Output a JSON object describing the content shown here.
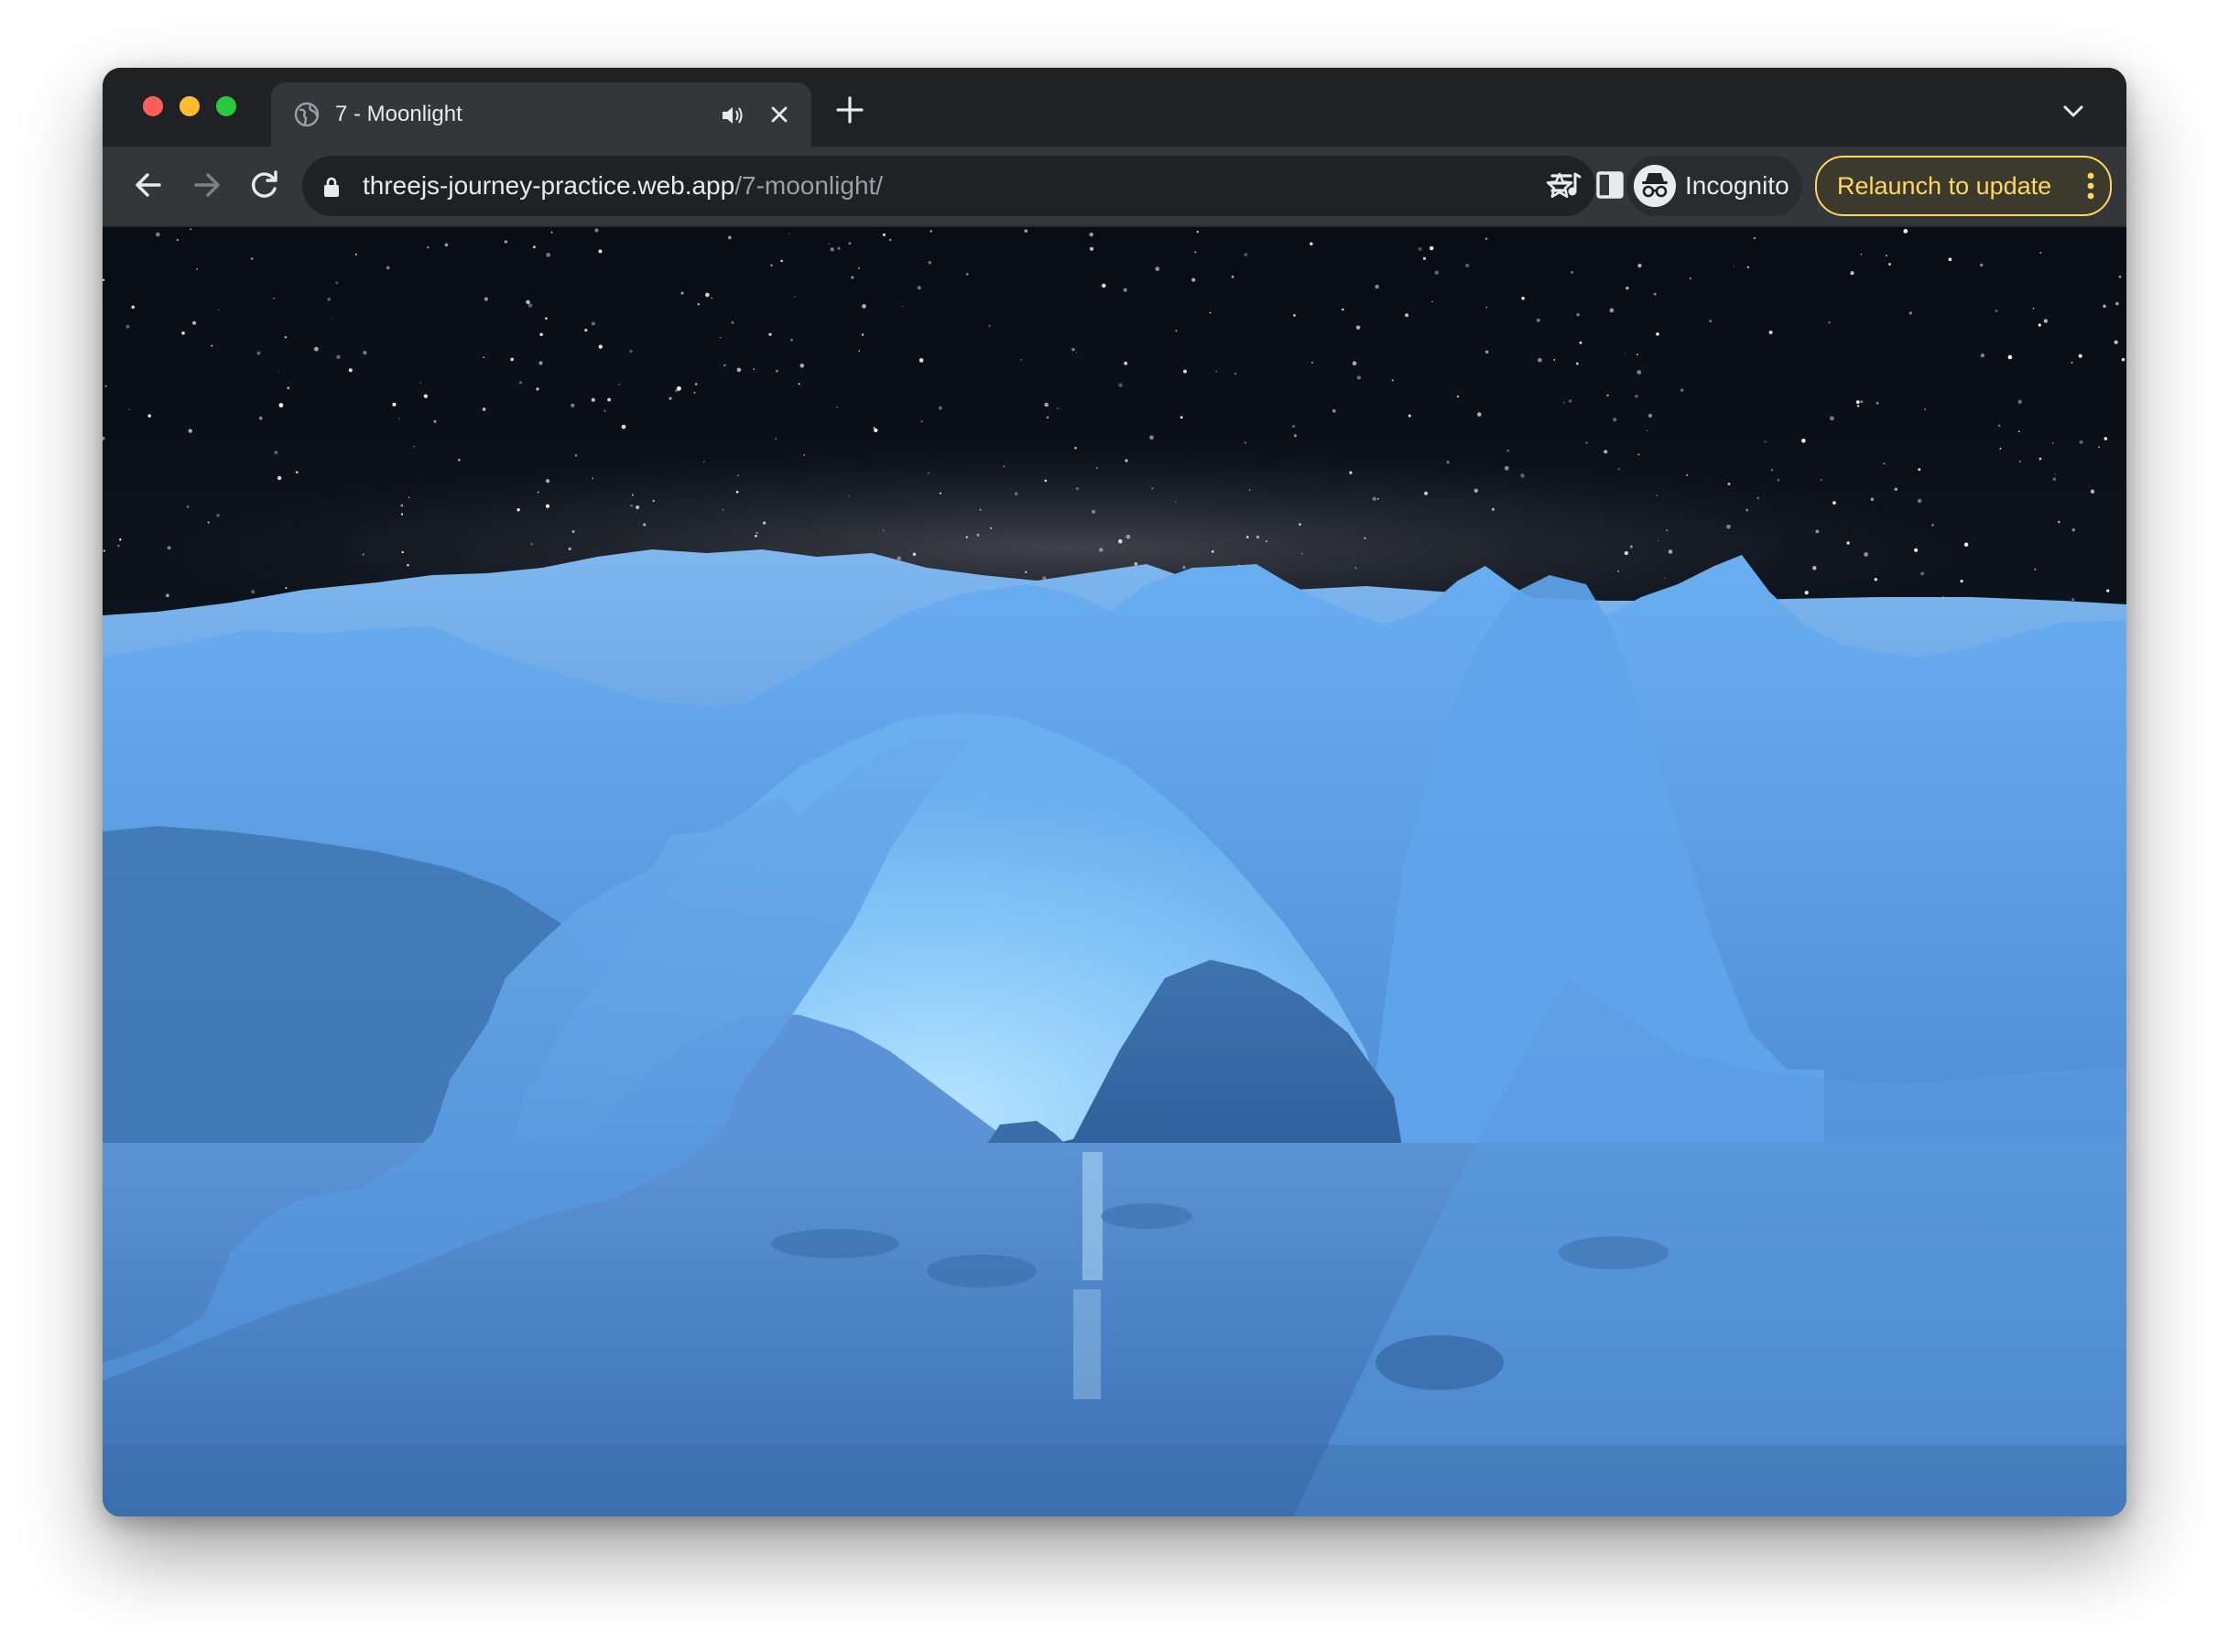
{
  "window": {
    "controls": {
      "close": "close-window",
      "minimize": "minimize-window",
      "zoom": "zoom-window"
    }
  },
  "tab": {
    "title": "7 - Moonlight",
    "favicon": "globe-icon",
    "audio_icon": "speaker-icon",
    "close_icon": "close-icon"
  },
  "tabstrip": {
    "new_tab_icon": "plus-icon",
    "tab_search_icon": "chevron-down-icon"
  },
  "toolbar": {
    "back_icon": "arrow-left-icon",
    "forward_icon": "arrow-right-icon",
    "reload_icon": "reload-icon",
    "url_host": "threejs-journey-practice.web.app",
    "url_path": "/7-moonlight/",
    "bookmark_icon": "star-icon",
    "media_icon": "media-control-icon",
    "side_panel_icon": "side-panel-icon",
    "profile_label": "Incognito",
    "relaunch_label": "Relaunch to update"
  },
  "colors": {
    "frame": "#202124",
    "toolbar": "#35363a",
    "relaunch_accent": "#fdd663",
    "sky": "#0b121c",
    "terrain_light": "#8cc6fb",
    "terrain_mid": "#5592d8",
    "water": "#3d73b5"
  }
}
